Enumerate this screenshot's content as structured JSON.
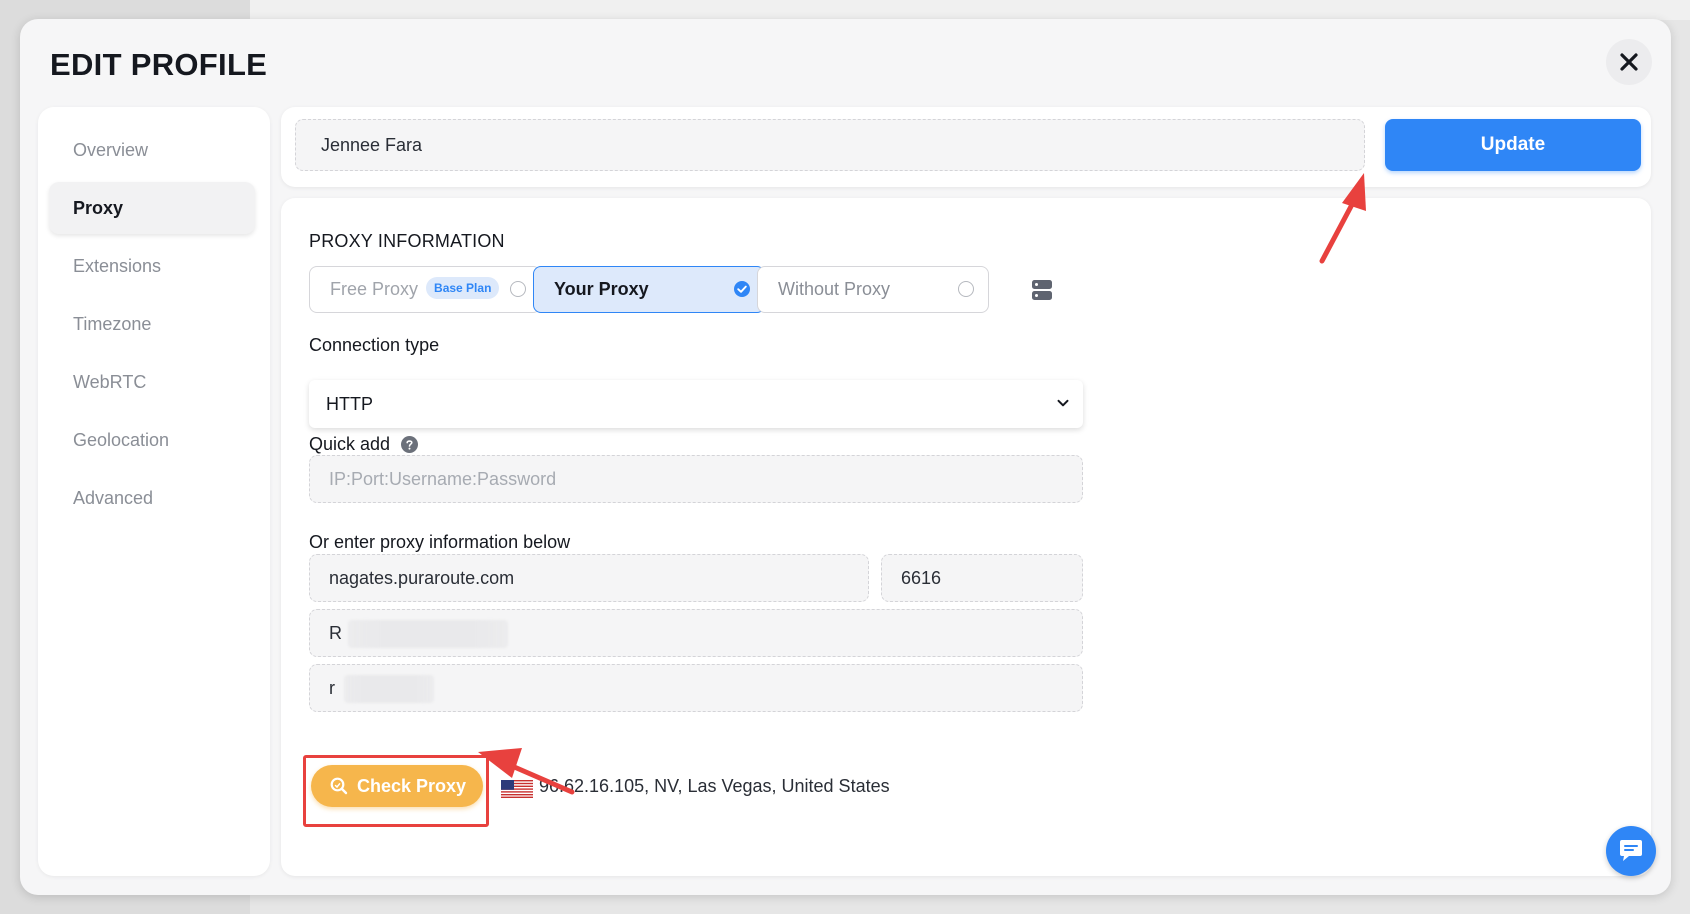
{
  "modal": {
    "title": "EDIT PROFILE"
  },
  "sidebar": {
    "items": [
      {
        "label": "Overview"
      },
      {
        "label": "Proxy"
      },
      {
        "label": "Extensions"
      },
      {
        "label": "Timezone"
      },
      {
        "label": "WebRTC"
      },
      {
        "label": "Geolocation"
      },
      {
        "label": "Advanced"
      }
    ],
    "active": "Proxy"
  },
  "profile": {
    "name": "Jennee Fara",
    "update_label": "Update"
  },
  "proxy": {
    "section_title": "PROXY INFORMATION",
    "options": [
      {
        "label": "Free Proxy",
        "badge": "Base Plan",
        "selected": false
      },
      {
        "label": "Your Proxy",
        "selected": true
      },
      {
        "label": "Without Proxy",
        "selected": false
      }
    ],
    "connection_type_label": "Connection type",
    "connection_type_value": "HTTP",
    "quick_add_label": "Quick add",
    "quick_add_placeholder": "IP:Port:Username:Password",
    "manual_label": "Or enter proxy information below",
    "host": "nagates.puraroute.com",
    "port": "6616",
    "username": "R",
    "password": "r",
    "check_label": "Check Proxy",
    "result": "96.62.16.105, NV, Las Vegas, United States",
    "result_flag": "us-flag-icon"
  },
  "colors": {
    "accent": "#2f86f6",
    "check_button": "#f6b64c",
    "annotation": "#e8413e"
  }
}
